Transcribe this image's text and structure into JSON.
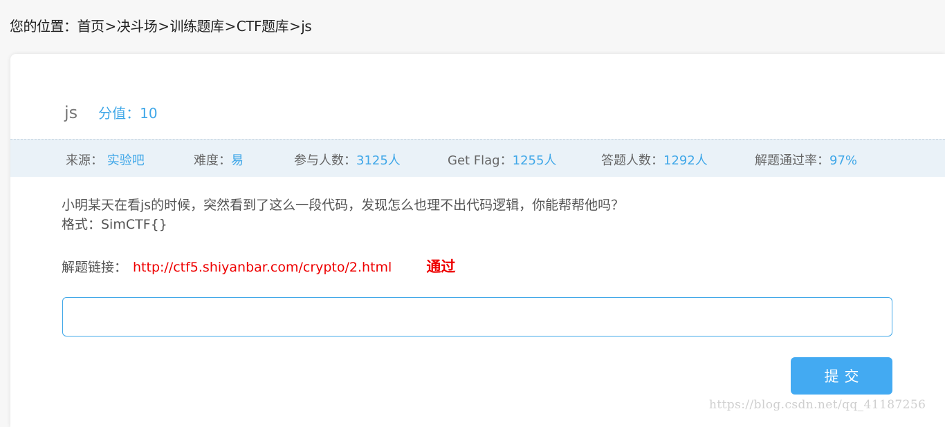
{
  "breadcrumb": {
    "prefix": "您的位置：",
    "items": [
      "首页",
      "决斗场",
      "训练题库",
      "CTF题库",
      "js"
    ],
    "separator": ">"
  },
  "challenge": {
    "title": "js",
    "score_label": "分值：",
    "score_value": "10"
  },
  "stats": {
    "source_label": "来源：",
    "source_value": "实验吧",
    "difficulty_label": "难度：",
    "difficulty_value": "易",
    "participants_label": "参与人数：",
    "participants_value": "3125人",
    "getflag_label": "Get Flag：",
    "getflag_value": "1255人",
    "answered_label": "答题人数：",
    "answered_value": "1292人",
    "passrate_label": "解题通过率：",
    "passrate_value": "97%"
  },
  "description": {
    "line1": "小明某天在看js的时候，突然看到了这么一段代码，发现怎么也理不出代码逻辑，你能帮帮他吗？",
    "line2": "格式：SimCTF{}"
  },
  "solve": {
    "link_label": "解题链接：",
    "link_text": "http://ctf5.shiyanbar.com/crypto/2.html",
    "status": "通过"
  },
  "form": {
    "input_value": "",
    "submit_label": "提交"
  },
  "watermark": "https://blog.csdn.net/qq_41187256",
  "colors": {
    "accent": "#3fa7e8",
    "link": "#ee0000",
    "button": "#43aaf2"
  }
}
